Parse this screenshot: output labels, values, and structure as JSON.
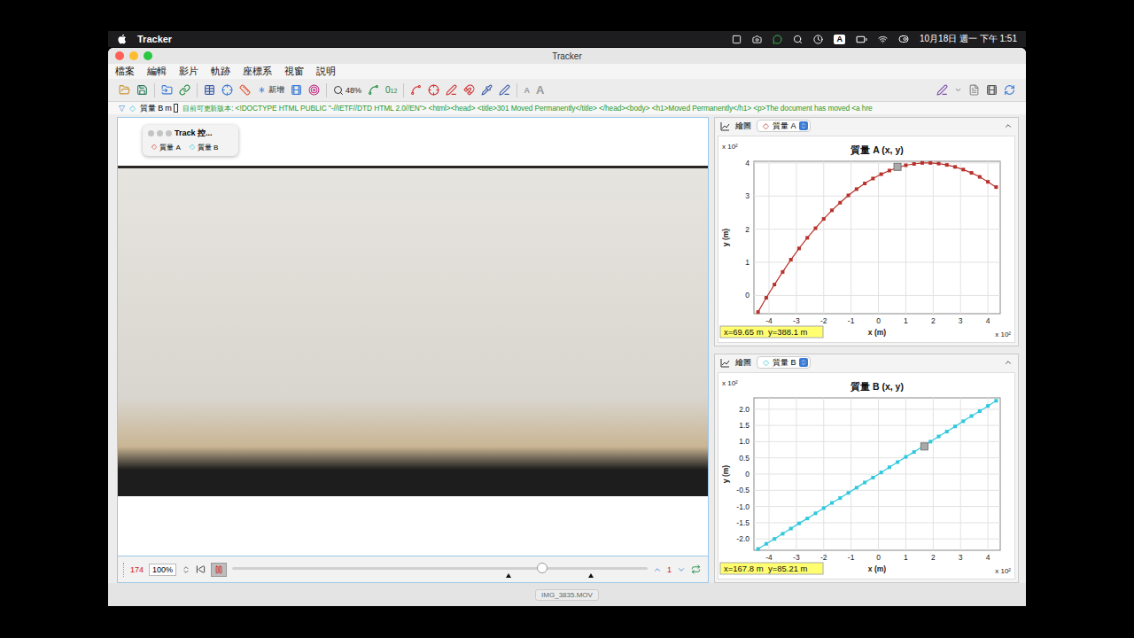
{
  "menubar": {
    "app": "Tracker",
    "input_method": "A",
    "clock": "10月18日 週一 下午 1:51"
  },
  "window": {
    "title": "Tracker"
  },
  "menu": [
    "檔案",
    "編輯",
    "影片",
    "軌跡",
    "座標系",
    "視窗",
    "説明"
  ],
  "toolbar": {
    "new": "新增",
    "zoom": "48%",
    "steps_base": "0",
    "steps_sup": "1",
    "steps_sub": "2",
    "font_buttons": [
      "A",
      "A"
    ]
  },
  "trackbar": {
    "marker": "▽",
    "symbol": "◇",
    "track": "質量 B",
    "unit": "m",
    "notice": "目前可更新版本: <!DOCTYPE HTML PUBLIC \"-//IETF//DTD HTML 2.0//EN\"> <html><head> <title>301 Moved Permanently</title> </head><body> <h1>Moved Permanently</h1> <p>The document has moved <a hre"
  },
  "palette": {
    "title": "Track 控...",
    "tracks": [
      {
        "name": "質量 A",
        "symbol": "◇",
        "color": "#e03a30"
      },
      {
        "name": "質量 B",
        "symbol": "◇",
        "color": "#2fc8dc"
      }
    ]
  },
  "video": {
    "filename": "IMG_3835.MOV"
  },
  "player": {
    "frame": "174",
    "zoom": "100%",
    "step": "1",
    "playing": true,
    "level": 0.746,
    "clip_marks": [
      0.666,
      0.864
    ]
  },
  "plots": [
    {
      "header": "繪圖",
      "track": "質量 A",
      "symbol": "◇",
      "color": "#b8322c",
      "title": "質量 A (x, y)",
      "x_label": "x (m)",
      "y_label": "y (m)",
      "exponent": "x 10²",
      "x_range": [
        -4.55,
        4.45
      ],
      "y_range": [
        -0.55,
        4.05
      ],
      "x_ticks": [
        "-4",
        "-3",
        "-2",
        "-1",
        "0",
        "1",
        "2",
        "3",
        "4"
      ],
      "y_ticks": [
        "0",
        "1",
        "2",
        "3",
        "4"
      ],
      "x_values": [
        -4.4,
        -4.1,
        -3.8,
        -3.5,
        -3.2,
        -2.9,
        -2.6,
        -2.3,
        -2.0,
        -1.7,
        -1.4,
        -1.1,
        -0.8,
        -0.5,
        -0.2,
        0.1,
        0.4,
        0.7,
        1.0,
        1.3,
        1.6,
        1.9,
        2.2,
        2.5,
        2.8,
        3.1,
        3.4,
        3.7,
        4.0,
        4.3
      ],
      "y_values": [
        -0.5,
        -0.07,
        0.33,
        0.71,
        1.08,
        1.42,
        1.74,
        2.03,
        2.31,
        2.57,
        2.8,
        3.02,
        3.21,
        3.38,
        3.53,
        3.66,
        3.77,
        3.86,
        3.93,
        3.97,
        4.0,
        4.0,
        3.98,
        3.94,
        3.88,
        3.8,
        3.7,
        3.58,
        3.43,
        3.27
      ],
      "cursor": [
        0.6965,
        3.881
      ],
      "readout": "x=69.65 m  y=388.1 m"
    },
    {
      "header": "繪圖",
      "track": "質量 B",
      "symbol": "◇",
      "color": "#2fc8dc",
      "title": "質量 B (x, y)",
      "x_label": "x (m)",
      "y_label": "y (m)",
      "exponent": "x 10²",
      "x_range": [
        -4.55,
        4.45
      ],
      "y_range": [
        -2.35,
        2.35
      ],
      "x_ticks": [
        "-4",
        "-3",
        "-2",
        "-1",
        "0",
        "1",
        "2",
        "3",
        "4"
      ],
      "y_ticks": [
        "-2.0",
        "-1.5",
        "-1.0",
        "-0.5",
        "0",
        "0.5",
        "1.0",
        "1.5",
        "2.0"
      ],
      "x_values": [
        -4.4,
        -4.1,
        -3.8,
        -3.5,
        -3.2,
        -2.9,
        -2.6,
        -2.3,
        -2.0,
        -1.7,
        -1.4,
        -1.1,
        -0.8,
        -0.5,
        -0.2,
        0.1,
        0.4,
        0.7,
        1.0,
        1.3,
        1.6,
        1.9,
        2.2,
        2.5,
        2.8,
        3.1,
        3.4,
        3.7,
        4.0,
        4.3
      ],
      "y_values": [
        -2.31,
        -2.15,
        -2.0,
        -1.84,
        -1.68,
        -1.52,
        -1.37,
        -1.21,
        -1.05,
        -0.89,
        -0.74,
        -0.58,
        -0.42,
        -0.26,
        -0.11,
        0.05,
        0.21,
        0.37,
        0.53,
        0.68,
        0.84,
        1.0,
        1.16,
        1.31,
        1.47,
        1.63,
        1.79,
        1.94,
        2.1,
        2.26
      ],
      "cursor": [
        1.678,
        0.852
      ],
      "readout": "x=167.8 m  y=85.21 m"
    }
  ]
}
